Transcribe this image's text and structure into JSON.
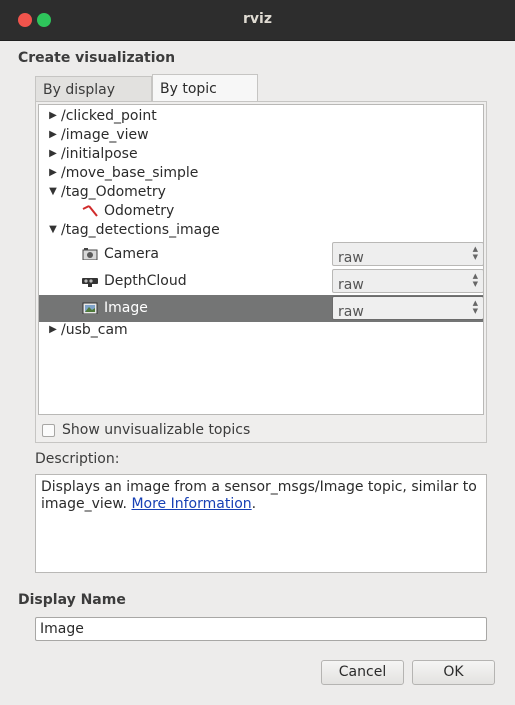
{
  "window": {
    "title": "rviz"
  },
  "header": {
    "create_label": "Create visualization"
  },
  "tabs": [
    {
      "label": "By display type",
      "active": false
    },
    {
      "label": "By topic",
      "active": true
    }
  ],
  "tree": {
    "rows": [
      {
        "label": "/clicked_point",
        "arrow": "▶",
        "icon": ""
      },
      {
        "label": "/image_view",
        "arrow": "▶",
        "icon": ""
      },
      {
        "label": "/initialpose",
        "arrow": "▶",
        "icon": ""
      },
      {
        "label": "/move_base_simple",
        "arrow": "▶",
        "icon": ""
      },
      {
        "label": "/tag_Odometry",
        "arrow": "▼",
        "icon": ""
      },
      {
        "label": "Odometry",
        "arrow": "",
        "icon": "odometry-icon"
      },
      {
        "label": "/tag_detections_image",
        "arrow": "▼",
        "icon": ""
      },
      {
        "label": "Camera",
        "arrow": "",
        "icon": "camera-icon",
        "transport": "raw"
      },
      {
        "label": "DepthCloud",
        "arrow": "",
        "icon": "depthcloud-icon",
        "transport": "raw"
      },
      {
        "label": "Image",
        "arrow": "",
        "icon": "image-icon",
        "transport": "raw",
        "selected": true
      },
      {
        "label": "/usb_cam",
        "arrow": "▶",
        "icon": ""
      }
    ]
  },
  "show_unvisualizable": {
    "label": "Show unvisualizable topics",
    "checked": false
  },
  "description": {
    "label": "Description:",
    "text": "Displays an image from a sensor_msgs/Image topic, similar to image_view.",
    "link": "More Information",
    "suffix": "."
  },
  "display_name": {
    "label": "Display Name",
    "value": "Image"
  },
  "buttons": {
    "cancel": "Cancel",
    "ok": "OK"
  },
  "colors": {
    "selection": "#747575",
    "link": "#1740b5",
    "close": "#f0544c",
    "maximize": "#2ec55b"
  }
}
